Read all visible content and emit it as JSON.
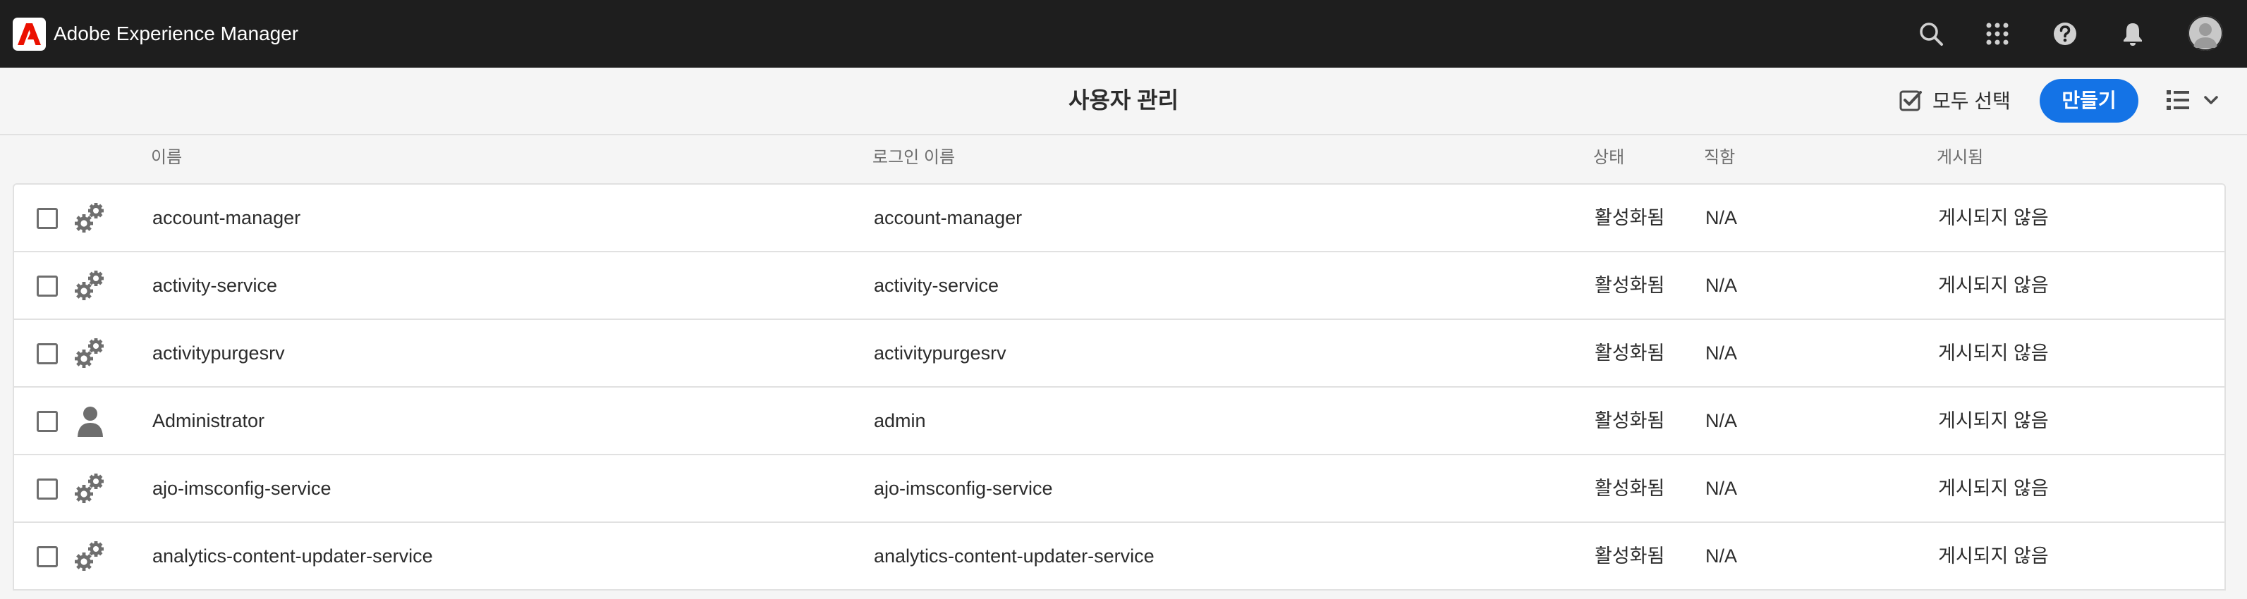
{
  "shell": {
    "product_name": "Adobe Experience Manager",
    "icons": [
      "search-icon",
      "apps-grid-icon",
      "help-icon",
      "bell-icon"
    ],
    "avatar": "user-avatar"
  },
  "actionbar": {
    "title": "사용자 관리",
    "select_all_label": "모두 선택",
    "create_label": "만들기",
    "view_icon": "list-view-icon"
  },
  "columns": {
    "name": "이름",
    "login": "로그인 이름",
    "status": "상태",
    "title": "직함",
    "published": "게시됨"
  },
  "colors": {
    "shell_bg": "#1e1e1e",
    "accent": "#1473e6",
    "logo_red": "#eb1000"
  },
  "rows": [
    {
      "icon": "service-user-icon",
      "name": "account-manager",
      "login": "account-manager",
      "status": "활성화됨",
      "title": "N/A",
      "published": "게시되지 않음"
    },
    {
      "icon": "service-user-icon",
      "name": "activity-service",
      "login": "activity-service",
      "status": "활성화됨",
      "title": "N/A",
      "published": "게시되지 않음"
    },
    {
      "icon": "service-user-icon",
      "name": "activitypurgesrv",
      "login": "activitypurgesrv",
      "status": "활성화됨",
      "title": "N/A",
      "published": "게시되지 않음"
    },
    {
      "icon": "user-icon",
      "name": "Administrator",
      "login": "admin",
      "status": "활성화됨",
      "title": "N/A",
      "published": "게시되지 않음"
    },
    {
      "icon": "service-user-icon",
      "name": "ajo-imsconfig-service",
      "login": "ajo-imsconfig-service",
      "status": "활성화됨",
      "title": "N/A",
      "published": "게시되지 않음"
    },
    {
      "icon": "service-user-icon",
      "name": "analytics-content-updater-service",
      "login": "analytics-content-updater-service",
      "status": "활성화됨",
      "title": "N/A",
      "published": "게시되지 않음"
    }
  ]
}
